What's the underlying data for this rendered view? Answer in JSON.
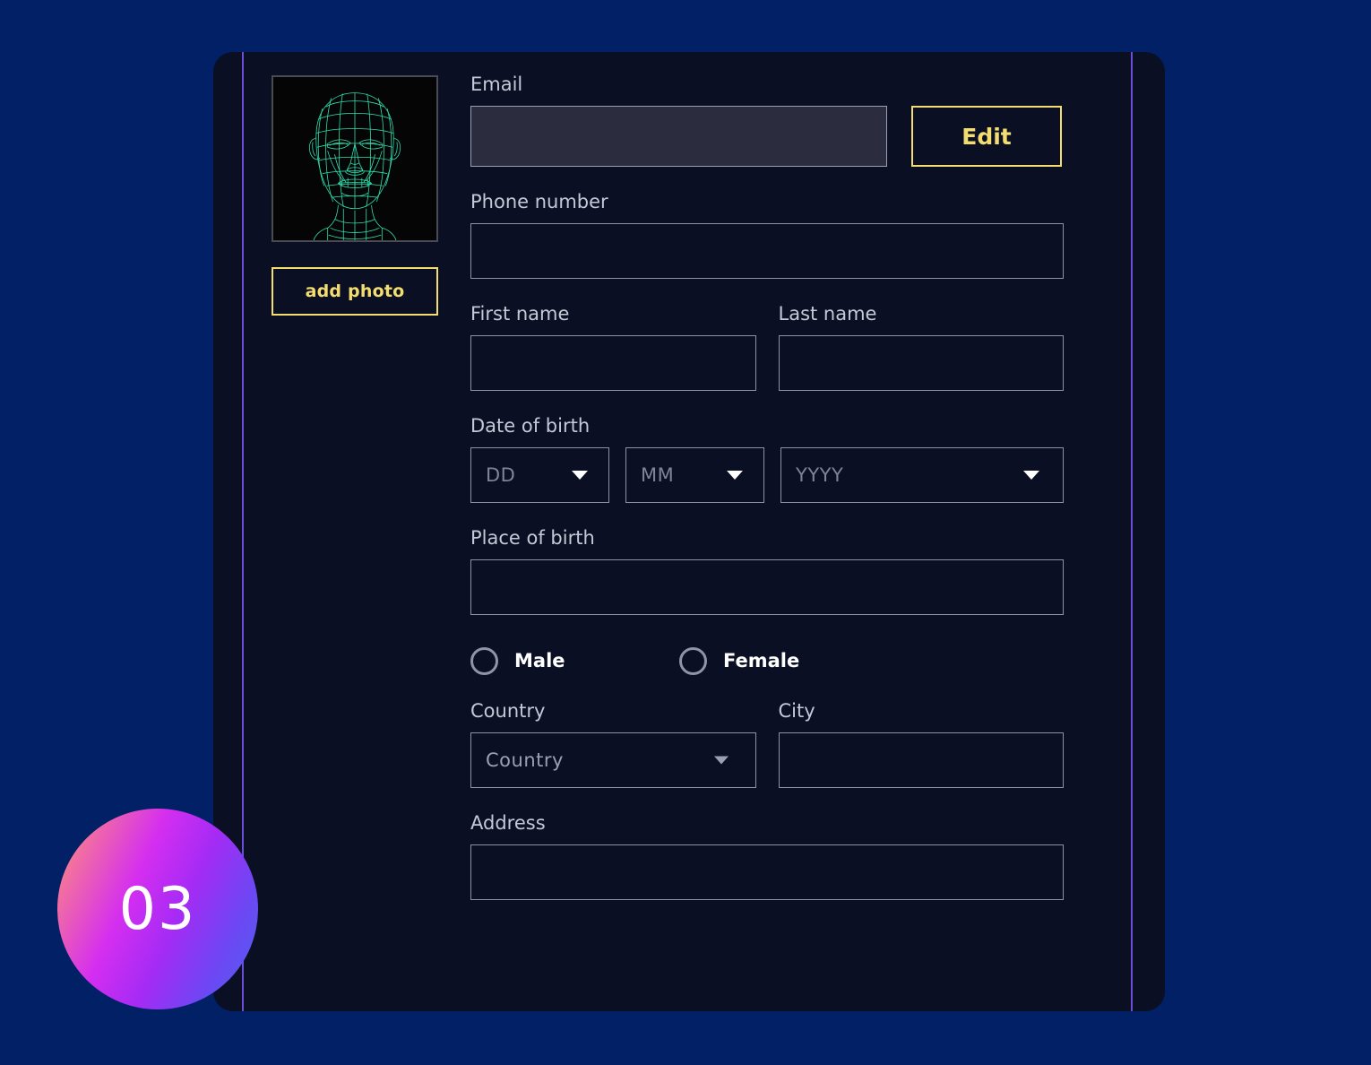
{
  "theme": {
    "page_background": "#012066",
    "card_background": "#0b0f24",
    "rail_color": "#6a4fd6",
    "accent_yellow": "#f2dd6e",
    "label_color": "#c5c9d6",
    "field_border": "#8d92a6",
    "email_field_fill": "#2b2c3e",
    "wireframe_color": "#2fe0b0",
    "badge_gradient_from": "#fca86a",
    "badge_gradient_mid": "#d42ef0",
    "badge_gradient_to": "#4f63f0"
  },
  "avatar": {
    "image_name": "wireframe-head",
    "add_photo_label": "add photo"
  },
  "form": {
    "email": {
      "label": "Email",
      "value": "",
      "placeholder": "",
      "edit_label": "Edit"
    },
    "phone": {
      "label": "Phone number",
      "value": "",
      "placeholder": ""
    },
    "first_name": {
      "label": "First name",
      "value": "",
      "placeholder": ""
    },
    "last_name": {
      "label": "Last name",
      "value": "",
      "placeholder": ""
    },
    "date_of_birth": {
      "label": "Date of birth",
      "day": {
        "selected": "DD",
        "options": [
          "DD"
        ]
      },
      "month": {
        "selected": "MM",
        "options": [
          "MM"
        ]
      },
      "year": {
        "selected": "YYYY",
        "options": [
          "YYYY"
        ]
      }
    },
    "place_of_birth": {
      "label": "Place of birth",
      "value": "",
      "placeholder": ""
    },
    "gender": {
      "male_label": "Male",
      "female_label": "Female",
      "selected": ""
    },
    "country": {
      "label": "Country",
      "selected": "Country",
      "options": [
        "Country"
      ]
    },
    "city": {
      "label": "City",
      "value": "",
      "placeholder": ""
    },
    "address": {
      "label": "Address",
      "value": "",
      "placeholder": ""
    }
  },
  "badge": {
    "number": "03"
  }
}
